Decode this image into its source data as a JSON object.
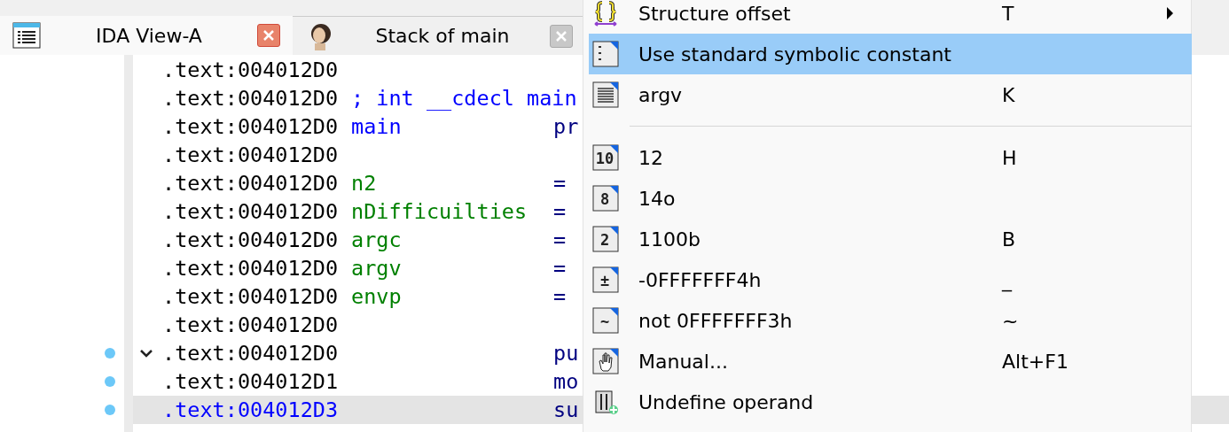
{
  "tabs": [
    {
      "label": "IDA View-A",
      "selected": true
    },
    {
      "label": "Stack of main",
      "selected": false
    }
  ],
  "listing": {
    "lines": [
      {
        "address": ".text:004012D0",
        "selected": false,
        "breakpoint": false,
        "collapse": false
      },
      {
        "address": ".text:004012D0",
        "text": "; int __cdecl main",
        "kind": "comment",
        "selected": false,
        "breakpoint": false,
        "collapse": false
      },
      {
        "address": ".text:004012D0",
        "text": "main",
        "kind": "proc",
        "operand": "pr",
        "selected": false,
        "breakpoint": false,
        "collapse": false
      },
      {
        "address": ".text:004012D0",
        "selected": false,
        "breakpoint": false,
        "collapse": false
      },
      {
        "address": ".text:004012D0",
        "text": "n2",
        "kind": "var",
        "operand": "=",
        "selected": false,
        "breakpoint": false,
        "collapse": false
      },
      {
        "address": ".text:004012D0",
        "text": "nDifficuilties",
        "kind": "var",
        "operand": "=",
        "selected": false,
        "breakpoint": false,
        "collapse": false
      },
      {
        "address": ".text:004012D0",
        "text": "argc",
        "kind": "var",
        "operand": "=",
        "selected": false,
        "breakpoint": false,
        "collapse": false
      },
      {
        "address": ".text:004012D0",
        "text": "argv",
        "kind": "var",
        "operand": "=",
        "selected": false,
        "breakpoint": false,
        "collapse": false
      },
      {
        "address": ".text:004012D0",
        "text": "envp",
        "kind": "var",
        "operand": "=",
        "selected": false,
        "breakpoint": false,
        "collapse": false
      },
      {
        "address": ".text:004012D0",
        "selected": false,
        "breakpoint": false,
        "collapse": false
      },
      {
        "address": ".text:004012D0",
        "operand": "pu",
        "selected": false,
        "breakpoint": true,
        "collapse": true
      },
      {
        "address": ".text:004012D1",
        "operand": "mo",
        "selected": false,
        "breakpoint": true,
        "collapse": false
      },
      {
        "address": ".text:004012D3",
        "operand": "su",
        "selected": true,
        "breakpoint": true,
        "collapse": false
      }
    ]
  },
  "context_menu": {
    "items": [
      {
        "kind": "item",
        "label": "Structure offset",
        "shortcut": "T",
        "submenu": true,
        "selected": false
      },
      {
        "kind": "item",
        "label": "Use standard symbolic constant",
        "submenu": false,
        "selected": true
      },
      {
        "kind": "item",
        "label": "argv",
        "shortcut": "K",
        "submenu": false,
        "selected": false
      },
      {
        "kind": "separator"
      },
      {
        "kind": "item",
        "glyph": "10",
        "label": "12",
        "shortcut": "H",
        "submenu": false,
        "selected": false
      },
      {
        "kind": "item",
        "glyph": "8",
        "label": "14o",
        "submenu": false,
        "selected": false
      },
      {
        "kind": "item",
        "glyph": "2",
        "label": "1100b",
        "shortcut": "B",
        "submenu": false,
        "selected": false
      },
      {
        "kind": "item",
        "glyph": "±",
        "label": "-0FFFFFFF4h",
        "shortcut": "_",
        "submenu": false,
        "selected": false
      },
      {
        "kind": "item",
        "glyph": "~",
        "label": "not 0FFFFFFF3h",
        "shortcut": "~",
        "submenu": false,
        "selected": false
      },
      {
        "kind": "item",
        "label": "Manual...",
        "shortcut": "Alt+F1",
        "submenu": false,
        "selected": false
      },
      {
        "kind": "item",
        "label": "Undefine operand",
        "submenu": false,
        "selected": false
      }
    ]
  }
}
